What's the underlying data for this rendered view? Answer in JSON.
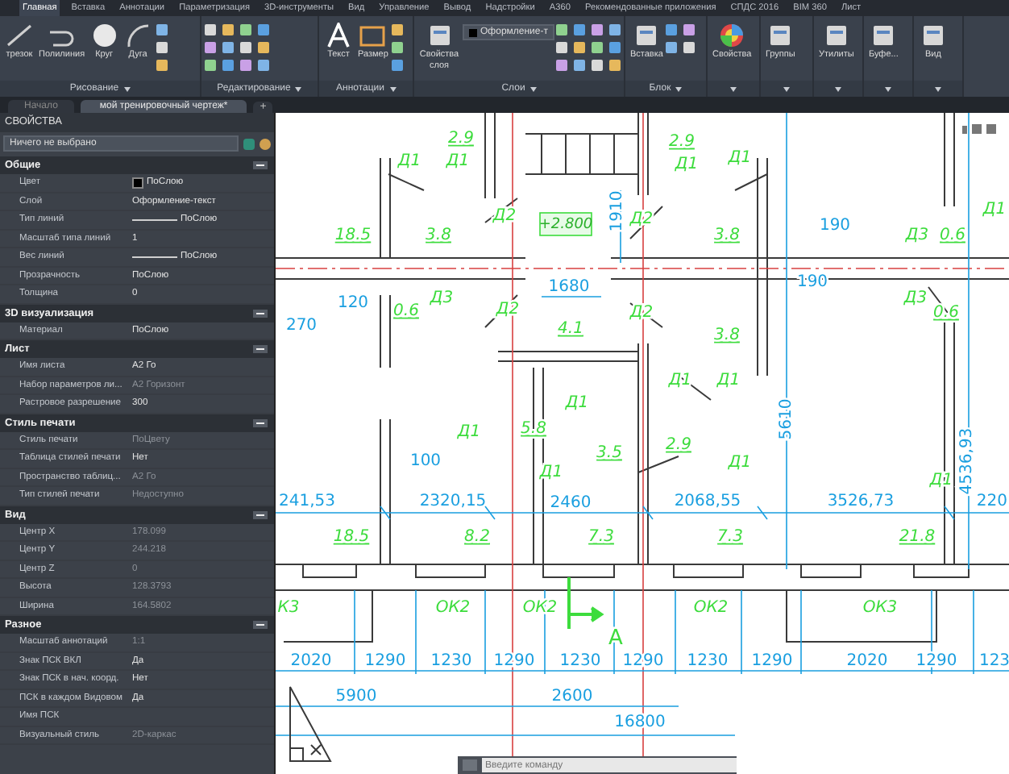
{
  "ribbon": {
    "tabs": [
      {
        "label": "Главная",
        "selected": true
      },
      {
        "label": "Вставка",
        "selected": false
      },
      {
        "label": "Аннотации",
        "selected": false
      },
      {
        "label": "Параметризация",
        "selected": false
      },
      {
        "label": "3D-инструменты",
        "selected": false
      },
      {
        "label": "Вид",
        "selected": false
      },
      {
        "label": "Управление",
        "selected": false
      },
      {
        "label": "Вывод",
        "selected": false
      },
      {
        "label": "Надстройки",
        "selected": false
      },
      {
        "label": "A360",
        "selected": false
      },
      {
        "label": "Рекомендованные приложения",
        "selected": false
      },
      {
        "label": "СПДС 2016",
        "selected": false
      },
      {
        "label": "BIM 360",
        "selected": false
      },
      {
        "label": "Лист",
        "selected": false
      }
    ],
    "panels": [
      {
        "title": "Рисование",
        "buttons": [
          "трезок",
          "Полилиния",
          "Круг",
          "Дуга"
        ]
      },
      {
        "title": "Редактирование"
      },
      {
        "title": "Аннотации",
        "buttons": [
          "Текст",
          "Размер"
        ]
      },
      {
        "title": "Слои",
        "buttons": [
          "Свойства слоя"
        ],
        "layer_field": "Оформление-т"
      },
      {
        "title": "Блок",
        "buttons": [
          "Вставка"
        ]
      },
      {
        "buttons": [
          "Свойства"
        ]
      },
      {
        "buttons": [
          "Группы"
        ]
      },
      {
        "buttons": [
          "Утилиты"
        ]
      },
      {
        "buttons": [
          "Буфе..."
        ]
      },
      {
        "buttons": [
          "Вид"
        ]
      }
    ]
  },
  "document_tabs": [
    {
      "label": "Начало",
      "selected": false
    },
    {
      "label": "мой тренировочный чертеж*",
      "selected": true
    }
  ],
  "new_tab": "+",
  "properties": {
    "title": "СВОЙСТВА",
    "selection": "Ничего не выбрано",
    "sections": [
      {
        "title": "Общие",
        "expanded": true,
        "rows": [
          {
            "label": "Цвет",
            "value": "ПоСлою",
            "kind": "swatch",
            "disabled": false
          },
          {
            "label": "Слой",
            "value": "Оформление-текст",
            "kind": "text",
            "disabled": false
          },
          {
            "label": "Тип линий",
            "value": "ПоСлою",
            "kind": "line",
            "disabled": false
          },
          {
            "label": "Масштаб типа линий",
            "value": "1",
            "kind": "text",
            "disabled": false
          },
          {
            "label": "Вес линий",
            "value": "ПоСлою",
            "kind": "line",
            "disabled": false
          },
          {
            "label": "Прозрачность",
            "value": "ПоСлою",
            "kind": "text",
            "disabled": false
          },
          {
            "label": "Толщина",
            "value": "0",
            "kind": "text",
            "disabled": false
          }
        ]
      },
      {
        "title": "3D визуализация",
        "expanded": true,
        "rows": [
          {
            "label": "Материал",
            "value": "ПоСлою",
            "kind": "text",
            "disabled": false
          }
        ]
      },
      {
        "title": "Лист",
        "expanded": true,
        "rows": [
          {
            "label": "Имя листа",
            "value": "А2 Го",
            "kind": "text",
            "disabled": false
          },
          {
            "label": "Набор параметров ли...",
            "value": "А2 Горизонт",
            "kind": "text",
            "disabled": true
          },
          {
            "label": "Растровое разрешение",
            "value": "300",
            "kind": "text",
            "disabled": false
          }
        ]
      },
      {
        "title": "Стиль печати",
        "expanded": true,
        "rows": [
          {
            "label": "Стиль печати",
            "value": "ПоЦвету",
            "kind": "text",
            "disabled": true
          },
          {
            "label": "Таблица стилей печати",
            "value": "Нет",
            "kind": "text",
            "disabled": false
          },
          {
            "label": "Пространство таблиц...",
            "value": "А2 Го",
            "kind": "text",
            "disabled": true
          },
          {
            "label": "Тип стилей печати",
            "value": "Недоступно",
            "kind": "text",
            "disabled": true
          }
        ]
      },
      {
        "title": "Вид",
        "expanded": true,
        "rows": [
          {
            "label": "Центр X",
            "value": "178.099",
            "kind": "text",
            "disabled": true
          },
          {
            "label": "Центр Y",
            "value": "244.218",
            "kind": "text",
            "disabled": true
          },
          {
            "label": "Центр Z",
            "value": "0",
            "kind": "text",
            "disabled": true
          },
          {
            "label": "Высота",
            "value": "128.3793",
            "kind": "text",
            "disabled": true
          },
          {
            "label": "Ширина",
            "value": "164.5802",
            "kind": "text",
            "disabled": true
          }
        ]
      },
      {
        "title": "Разное",
        "expanded": true,
        "rows": [
          {
            "label": "Масштаб аннотаций",
            "value": "1:1",
            "kind": "text",
            "disabled": true
          },
          {
            "label": "Знак ПСК ВКЛ",
            "value": "Да",
            "kind": "text",
            "disabled": false
          },
          {
            "label": "Знак ПСК в нач. коорд.",
            "value": "Нет",
            "kind": "text",
            "disabled": false
          },
          {
            "label": "ПСК в каждом Видовом",
            "value": "Да",
            "kind": "text",
            "disabled": false
          },
          {
            "label": "Имя ПСК",
            "disabled": false
          },
          {
            "label": "Визуальный стиль",
            "value": "2D-каркас",
            "kind": "text",
            "disabled": true
          }
        ]
      }
    ]
  },
  "drawing": {
    "labels": [
      {
        "text": "2.9",
        "kind": "area"
      },
      {
        "text": "2.9",
        "kind": "area"
      },
      {
        "text": "Д1",
        "kind": "door"
      },
      {
        "text": "Д1",
        "kind": "door"
      },
      {
        "text": "Д1",
        "kind": "door"
      },
      {
        "text": "Д1",
        "kind": "door"
      },
      {
        "text": "Д2",
        "kind": "door"
      },
      {
        "text": "+2.800",
        "kind": "elevation"
      },
      {
        "text": "1910",
        "kind": "dim_vertical"
      },
      {
        "text": "Д2",
        "kind": "door"
      },
      {
        "text": "18.5",
        "kind": "area"
      },
      {
        "text": "3.8",
        "kind": "area"
      },
      {
        "text": "3.8",
        "kind": "area"
      },
      {
        "text": "190",
        "kind": "dim"
      },
      {
        "text": "Д3",
        "kind": "door"
      },
      {
        "text": "0.6",
        "kind": "area"
      },
      {
        "text": "Д1",
        "kind": "door"
      },
      {
        "text": "1680",
        "kind": "dim"
      },
      {
        "text": "190",
        "kind": "dim"
      },
      {
        "text": "120",
        "kind": "dim"
      },
      {
        "text": "270",
        "kind": "dim"
      },
      {
        "text": "Д3",
        "kind": "door"
      },
      {
        "text": "0.6",
        "kind": "area"
      },
      {
        "text": "Д2",
        "kind": "door"
      },
      {
        "text": "Д2",
        "kind": "door"
      },
      {
        "text": "Д3",
        "kind": "door"
      },
      {
        "text": "0.6",
        "kind": "area"
      },
      {
        "text": "4.1",
        "kind": "area"
      },
      {
        "text": "3.8",
        "kind": "area"
      },
      {
        "text": "Д1",
        "kind": "door"
      },
      {
        "text": "Д1",
        "kind": "door"
      },
      {
        "text": "Д1",
        "kind": "door"
      },
      {
        "text": "5610",
        "kind": "dim_vertical"
      },
      {
        "text": "Д1",
        "kind": "door"
      },
      {
        "text": "5.8",
        "kind": "area"
      },
      {
        "text": "100",
        "kind": "dim"
      },
      {
        "text": "3.5",
        "kind": "area"
      },
      {
        "text": "2.9",
        "kind": "area"
      },
      {
        "text": "Д1",
        "kind": "door"
      },
      {
        "text": "Д1",
        "kind": "door"
      },
      {
        "text": "4536,93",
        "kind": "dim_vertical"
      },
      {
        "text": "Д1",
        "kind": "door"
      },
      {
        "text": "241,53",
        "kind": "dim"
      },
      {
        "text": "2320,15",
        "kind": "dim"
      },
      {
        "text": "2460",
        "kind": "dim"
      },
      {
        "text": "2068,55",
        "kind": "dim"
      },
      {
        "text": "3526,73",
        "kind": "dim"
      },
      {
        "text": "220",
        "kind": "dim"
      },
      {
        "text": "18.5",
        "kind": "area"
      },
      {
        "text": "8.2",
        "kind": "area"
      },
      {
        "text": "7.3",
        "kind": "area"
      },
      {
        "text": "7.3",
        "kind": "area"
      },
      {
        "text": "21.8",
        "kind": "area"
      },
      {
        "text": "К3",
        "kind": "window"
      },
      {
        "text": "ОК2",
        "kind": "window"
      },
      {
        "text": "ОК2",
        "kind": "window"
      },
      {
        "text": "ОК2",
        "kind": "window"
      },
      {
        "text": "ОК3",
        "kind": "window"
      },
      {
        "text": "A",
        "kind": "section"
      },
      {
        "text": "2020",
        "kind": "dim"
      },
      {
        "text": "1290",
        "kind": "dim"
      },
      {
        "text": "1230",
        "kind": "dim"
      },
      {
        "text": "1290",
        "kind": "dim"
      },
      {
        "text": "1230",
        "kind": "dim"
      },
      {
        "text": "1290",
        "kind": "dim"
      },
      {
        "text": "1230",
        "kind": "dim"
      },
      {
        "text": "1290",
        "kind": "dim"
      },
      {
        "text": "2020",
        "kind": "dim"
      },
      {
        "text": "1290",
        "kind": "dim"
      },
      {
        "text": "123",
        "kind": "dim"
      },
      {
        "text": "5900",
        "kind": "dim"
      },
      {
        "text": "2600",
        "kind": "dim"
      },
      {
        "text": "16800",
        "kind": "dim"
      }
    ]
  },
  "command_line": {
    "placeholder": "Введите команду"
  }
}
